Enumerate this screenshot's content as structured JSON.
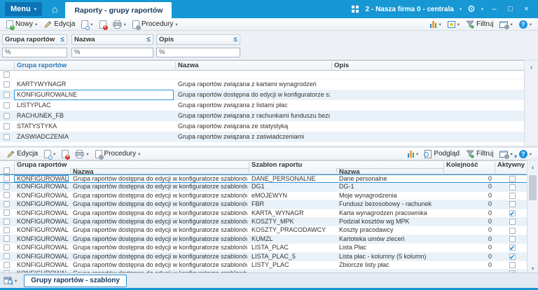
{
  "titlebar": {
    "menu": "Menu",
    "tab": "Raporty - grupy raportów",
    "company": "2 - Nasza firma 0 - centrala",
    "window_buttons": {
      "minimize": "–",
      "maximize": "□",
      "close": "×"
    }
  },
  "icons": {
    "home": "⌂",
    "gear": "⚙",
    "chevron_down": "▾",
    "collapse_left": "‹",
    "check": "✔",
    "help": "?"
  },
  "toolbar_main": {
    "new": "Nowy",
    "edit": "Edycja",
    "procedures": "Procedury",
    "filter": "Filtruj"
  },
  "toolbar_detail": {
    "edit": "Edycja",
    "procedures": "Procedury",
    "preview": "Podgląd",
    "filter": "Filtruj"
  },
  "filter_row": {
    "fields": [
      {
        "label": "Grupa raportów",
        "operator": "≤",
        "value": "%"
      },
      {
        "label": "Nazwa",
        "operator": "≤",
        "value": "%"
      },
      {
        "label": "Opis",
        "operator": "≤",
        "value": "%"
      }
    ]
  },
  "groups_grid": {
    "columns": {
      "group": "Grupa raportów",
      "name": "Nazwa",
      "desc": "Opis"
    },
    "rows": [
      {
        "group": "KARTYWYNAGR",
        "name": "Grupa raportów związana z kartami wynagrodzeń",
        "desc": "",
        "selected": false
      },
      {
        "group": "KONFIGUROWALNE",
        "name": "Grupa raportów dostępna do edycji w konfiguratorze szablonów raport",
        "desc": "",
        "selected": true
      },
      {
        "group": "LISTYPLAC",
        "name": "Grupa raportów związana z listami płac",
        "desc": "",
        "selected": false
      },
      {
        "group": "RACHUNEK_FB",
        "name": "Grupa raportów związana z rachunkami funduszu bezosobowego",
        "desc": "",
        "selected": false
      },
      {
        "group": "STATYSTYKA",
        "name": "Grupa raportów związana ze statystyką",
        "desc": "",
        "selected": false
      },
      {
        "group": "ZASWIADCZENIA",
        "name": "Grupa raportów związana z zaświadczeniami",
        "desc": "",
        "selected": false
      }
    ]
  },
  "templates_grid": {
    "columns": {
      "group": "Grupa raportów",
      "group_name": "Nazwa",
      "template": "Szablon raportu",
      "template_name": "Nazwa",
      "order": "Kolejność",
      "active": "Aktywny"
    },
    "rows": [
      {
        "group": "KONFIGUROWALNE",
        "group_name": "Grupa raportów dostępna do edycji w konfiguratorze szablonów raportów",
        "template": "DANE_PERSONALNE",
        "template_name": "Dane personalne",
        "order": "0",
        "active": false,
        "selected": true
      },
      {
        "group": "KONFIGUROWALNE",
        "group_name": "Grupa raportów dostępna do edycji w konfiguratorze szablonów raportów",
        "template": "DG1",
        "template_name": "DG-1",
        "order": "0",
        "active": false,
        "selected": false
      },
      {
        "group": "KONFIGUROWALNE",
        "group_name": "Grupa raportów dostępna do edycji w konfiguratorze szablonów raportów",
        "template": "eMOJEWYN",
        "template_name": "Moje wynagrodzenia",
        "order": "0",
        "active": false,
        "selected": false
      },
      {
        "group": "KONFIGUROWALNE",
        "group_name": "Grupa raportów dostępna do edycji w konfiguratorze szablonów raportów",
        "template": "FBR",
        "template_name": "Fundusz bezosobowy - rachunek",
        "order": "0",
        "active": false,
        "selected": false
      },
      {
        "group": "KONFIGUROWALNE",
        "group_name": "Grupa raportów dostępna do edycji w konfiguratorze szablonów raportów",
        "template": "KARTA_WYNAGR",
        "template_name": "Karta wynagrodzen pracownika",
        "order": "0",
        "active": true,
        "selected": false
      },
      {
        "group": "KONFIGUROWALNE",
        "group_name": "Grupa raportów dostępna do edycji w konfiguratorze szablonów raportów",
        "template": "KOSZTY_MPK",
        "template_name": "Podział kosztów wg MPK",
        "order": "0",
        "active": false,
        "selected": false
      },
      {
        "group": "KONFIGUROWALNE",
        "group_name": "Grupa raportów dostępna do edycji w konfiguratorze szablonów raportów",
        "template": "KOSZTY_PRACODAWCY",
        "template_name": "Koszty pracodawcy",
        "order": "0",
        "active": false,
        "selected": false
      },
      {
        "group": "KONFIGUROWALNE",
        "group_name": "Grupa raportów dostępna do edycji w konfiguratorze szablonów raportów",
        "template": "KUMZL",
        "template_name": "Kartoteka umów zleceń",
        "order": "0",
        "active": false,
        "selected": false
      },
      {
        "group": "KONFIGUROWALNE",
        "group_name": "Grupa raportów dostępna do edycji w konfiguratorze szablonów raportów",
        "template": "LISTA_PLAC",
        "template_name": "Lista Płac",
        "order": "0",
        "active": true,
        "selected": false
      },
      {
        "group": "KONFIGUROWALNE",
        "group_name": "Grupa raportów dostępna do edycji w konfiguratorze szablonów raportów",
        "template": "LISTA_PLAC_5",
        "template_name": "Lista płac - kolumny (5 kolumn)",
        "order": "0",
        "active": true,
        "selected": false
      },
      {
        "group": "KONFIGUROWALNE",
        "group_name": "Grupa raportów dostępna do edycji w konfiguratorze szablonów raportów",
        "template": "LISTY_PLAC",
        "template_name": "Zbiorcze listy płac",
        "order": "0",
        "active": false,
        "selected": false
      },
      {
        "group": "KONFIGUROWALNE",
        "group_name": "Grupa raportów dostępna do edycji w konfiguratorze szablonów raportów",
        "template": "",
        "template_name": "",
        "order": "",
        "active": true,
        "selected": false
      }
    ]
  },
  "bottom_bar": {
    "tab": "Grupy raportów - szablony"
  }
}
